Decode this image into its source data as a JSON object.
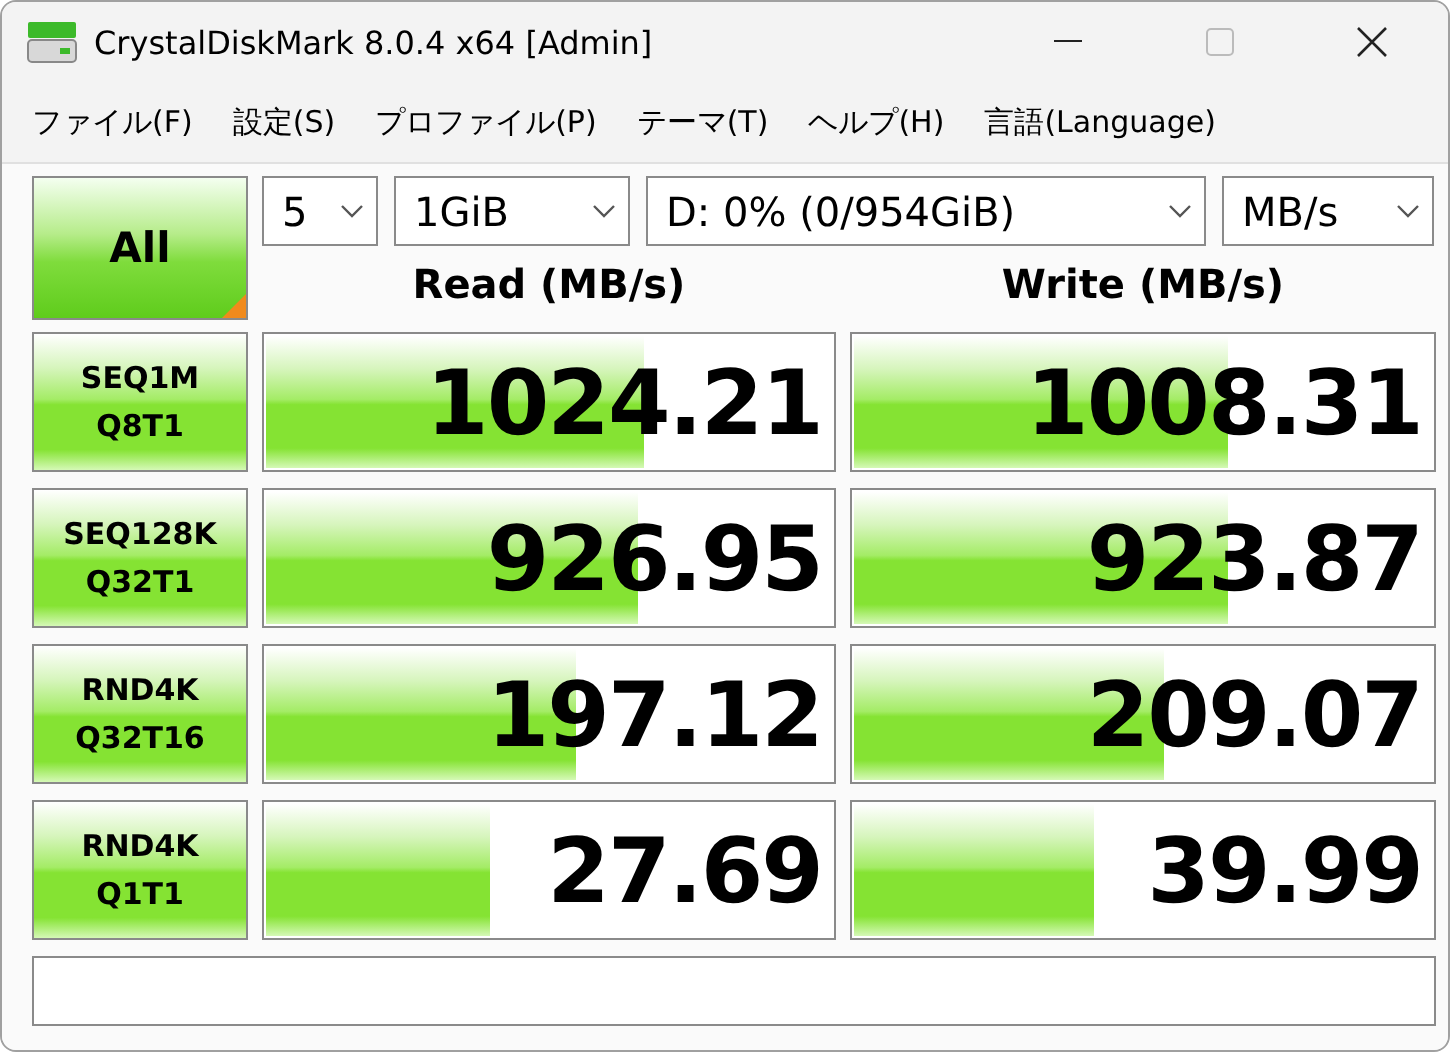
{
  "window": {
    "title": "CrystalDiskMark 8.0.4 x64 [Admin]"
  },
  "menu": [
    "ファイル(F)",
    "設定(S)",
    "プロファイル(P)",
    "テーマ(T)",
    "ヘルプ(H)",
    "言語(Language)"
  ],
  "all_button": "All",
  "selectors": [
    {
      "value": "5"
    },
    {
      "value": "1GiB"
    },
    {
      "value": "D: 0% (0/954GiB)"
    },
    {
      "value": "MB/s"
    }
  ],
  "headers": [
    "Read (MB/s)",
    "Write (MB/s)"
  ],
  "tests": [
    {
      "name": "SEQ1M",
      "params": "Q8T1",
      "read": {
        "value": "1024.21",
        "level": 0.67
      },
      "write": {
        "value": "1008.31",
        "level": 0.65
      }
    },
    {
      "name": "SEQ128K",
      "params": "Q32T1",
      "read": {
        "value": "926.95",
        "level": 0.66
      },
      "write": {
        "value": "923.87",
        "level": 0.65
      }
    },
    {
      "name": "RND4K",
      "params": "Q32T16",
      "read": {
        "value": "197.12",
        "level": 0.55
      },
      "write": {
        "value": "209.07",
        "level": 0.54
      }
    },
    {
      "name": "RND4K",
      "params": "Q1T1",
      "read": {
        "value": "27.69",
        "level": 0.4
      },
      "write": {
        "value": "39.99",
        "level": 0.42
      }
    }
  ]
}
